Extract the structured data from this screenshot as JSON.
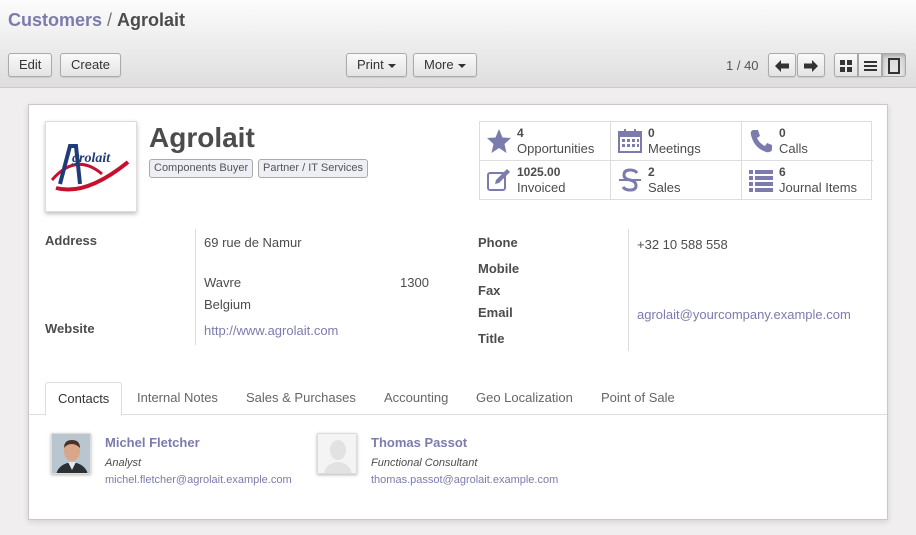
{
  "breadcrumb": {
    "parent": "Customers",
    "separator": "/",
    "current": "Agrolait"
  },
  "toolbar": {
    "edit_label": "Edit",
    "create_label": "Create",
    "print_label": "Print",
    "more_label": "More"
  },
  "pager": {
    "value": "1 / 40"
  },
  "partner": {
    "name": "Agrolait",
    "logo_text": "Agrolait",
    "tags": [
      "Components Buyer",
      "Partner / IT Services"
    ]
  },
  "stats": [
    {
      "value": "4",
      "label": "Opportunities",
      "icon": "star-icon"
    },
    {
      "value": "0",
      "label": "Meetings",
      "icon": "calendar-icon"
    },
    {
      "value": "0",
      "label": "Calls",
      "icon": "phone-icon"
    },
    {
      "value": "1025.00",
      "label": "Invoiced",
      "icon": "pencil-square-icon"
    },
    {
      "value": "2",
      "label": "Sales",
      "icon": "strikethrough-icon"
    },
    {
      "value": "6",
      "label": "Journal Items",
      "icon": "list-icon"
    }
  ],
  "fields": {
    "address_label": "Address",
    "street": "69 rue de Namur",
    "city": "Wavre",
    "zip": "1300",
    "country": "Belgium",
    "website_label": "Website",
    "website": "http://www.agrolait.com",
    "phone_label": "Phone",
    "phone": "+32 10 588 558",
    "mobile_label": "Mobile",
    "fax_label": "Fax",
    "email_label": "Email",
    "email": "agrolait@yourcompany.example.com",
    "title_label": "Title"
  },
  "tabs": [
    "Contacts",
    "Internal Notes",
    "Sales & Purchases",
    "Accounting",
    "Geo Localization",
    "Point of Sale"
  ],
  "contacts": [
    {
      "name": "Michel Fletcher",
      "function": "Analyst",
      "email": "michel.fletcher@agrolait.example.com"
    },
    {
      "name": "Thomas Passot",
      "function": "Functional Consultant",
      "email": "thomas.passot@agrolait.example.com"
    }
  ],
  "colors": {
    "link": "#7c7bad",
    "text": "#4c4c4c",
    "icon": "#7c7bad",
    "logo_red": "#c8102e",
    "logo_blue": "#1f3b7a"
  }
}
